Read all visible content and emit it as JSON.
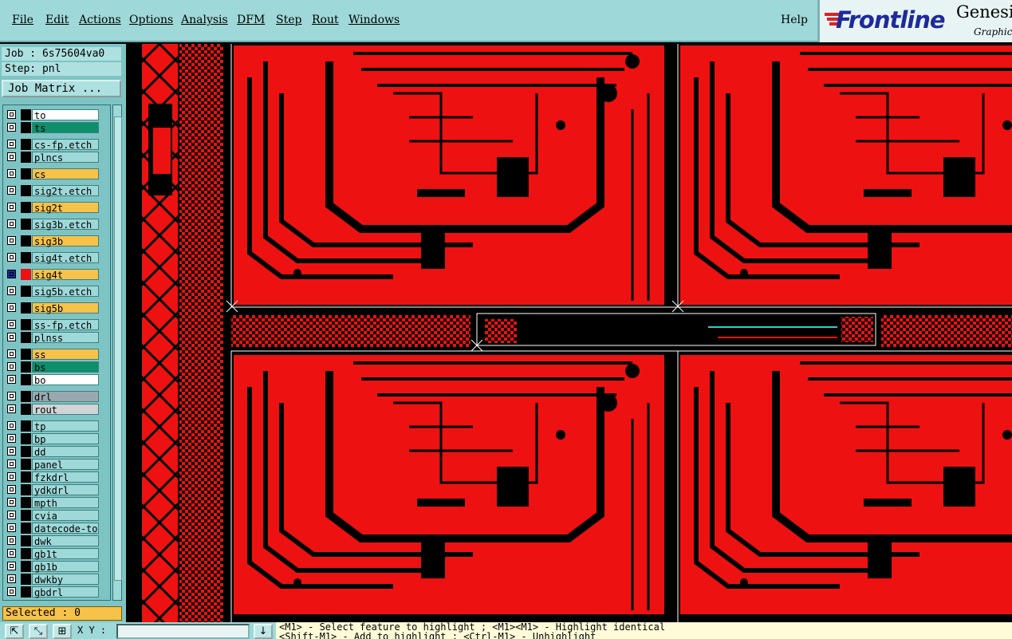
{
  "menu": {
    "file": "File",
    "edit": "Edit",
    "actions": "Actions",
    "options": "Options",
    "analysis": "Analysis",
    "dfm": "DFM",
    "step": "Step",
    "rout": "Rout",
    "windows": "Windows",
    "help": "Help"
  },
  "logo": {
    "brand": "Frontline",
    "product": "Genesi",
    "tag": "Graphic"
  },
  "job": {
    "job_line": "Job : 6s75604va0",
    "step_line": "Step: pnl",
    "matrix_button": "Job Matrix ..."
  },
  "layers": [
    {
      "name": "to",
      "color": "#ffffff",
      "chip": "#000000"
    },
    {
      "name": "ts",
      "color": "#0e8e6a",
      "chip": "#000000"
    },
    {
      "name": "cs-fp.etch",
      "color": "#9fd8d8",
      "chip": "#000000"
    },
    {
      "name": "plncs",
      "color": "#9fd8d8",
      "chip": "#000000"
    },
    {
      "name": "cs",
      "color": "#f6c24a",
      "chip": "#000000"
    },
    {
      "name": "sig2t.etch",
      "color": "#9fd8d8",
      "chip": "#000000"
    },
    {
      "name": "sig2t",
      "color": "#f6c24a",
      "chip": "#000000"
    },
    {
      "name": "sig3b.etch",
      "color": "#9fd8d8",
      "chip": "#000000"
    },
    {
      "name": "sig3b",
      "color": "#f6c24a",
      "chip": "#000000"
    },
    {
      "name": "sig4t.etch",
      "color": "#9fd8d8",
      "chip": "#000000"
    },
    {
      "name": "sig4t",
      "color": "#f6c24a",
      "chip": "#ee1111",
      "active": true
    },
    {
      "name": "sig5b.etch",
      "color": "#9fd8d8",
      "chip": "#000000"
    },
    {
      "name": "sig5b",
      "color": "#f6c24a",
      "chip": "#000000"
    },
    {
      "name": "ss-fp.etch",
      "color": "#9fd8d8",
      "chip": "#000000"
    },
    {
      "name": "plnss",
      "color": "#9fd8d8",
      "chip": "#000000"
    },
    {
      "name": "ss",
      "color": "#f6c24a",
      "chip": "#000000"
    },
    {
      "name": "bs",
      "color": "#0e8e6a",
      "chip": "#000000"
    },
    {
      "name": "bo",
      "color": "#ffffff",
      "chip": "#000000"
    },
    {
      "name": "drl",
      "color": "#9aa8b0",
      "chip": "#000000"
    },
    {
      "name": "rout",
      "color": "#d0d4d4",
      "chip": "#000000"
    },
    {
      "name": "tp",
      "color": "#9fd8d8",
      "chip": "#000000"
    },
    {
      "name": "bp",
      "color": "#9fd8d8",
      "chip": "#000000"
    },
    {
      "name": "dd",
      "color": "#9fd8d8",
      "chip": "#000000"
    },
    {
      "name": "panel",
      "color": "#9fd8d8",
      "chip": "#000000"
    },
    {
      "name": "fzkdrl",
      "color": "#9fd8d8",
      "chip": "#000000"
    },
    {
      "name": "ydkdrl",
      "color": "#9fd8d8",
      "chip": "#000000"
    },
    {
      "name": "mpth",
      "color": "#9fd8d8",
      "chip": "#000000"
    },
    {
      "name": "cvia",
      "color": "#9fd8d8",
      "chip": "#000000"
    },
    {
      "name": "datecode-to",
      "color": "#9fd8d8",
      "chip": "#000000"
    },
    {
      "name": "dwk",
      "color": "#9fd8d8",
      "chip": "#000000"
    },
    {
      "name": "gb1t",
      "color": "#9fd8d8",
      "chip": "#000000"
    },
    {
      "name": "gb1b",
      "color": "#9fd8d8",
      "chip": "#000000"
    },
    {
      "name": "dwkby",
      "color": "#9fd8d8",
      "chip": "#000000"
    },
    {
      "name": "gbdrl",
      "color": "#9fd8d8",
      "chip": "#000000"
    }
  ],
  "status": {
    "selected": "Selected : 0",
    "xy_label": "X Y :",
    "hint": "<M1> - Select feature to highlight ; <M1><M1> - Highlight identical\n<Shift-M1> - Add to highlight ; <Ctrl-M1> - Unhighlight"
  },
  "colors": {
    "copper": "#ee1111",
    "background": "#000000",
    "panel": "#7fc4c4",
    "highlight": "#f6c24a"
  }
}
